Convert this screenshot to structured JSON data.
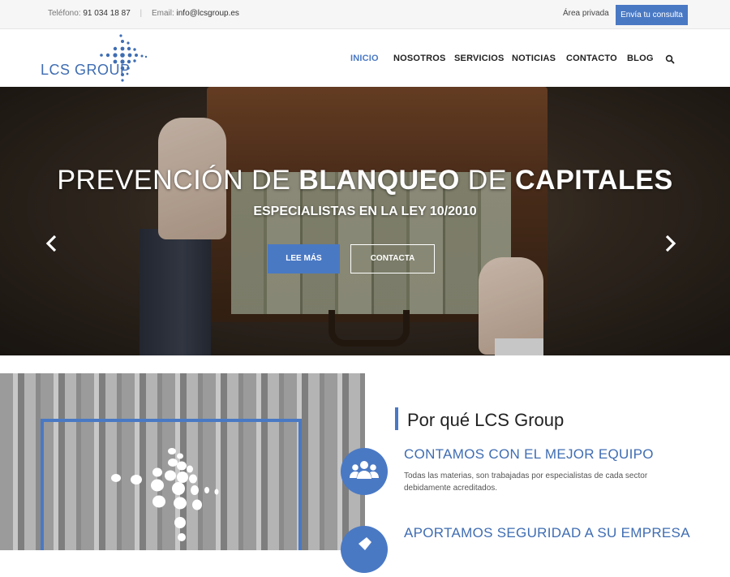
{
  "topbar": {
    "phone_label": "Teléfono:",
    "phone": "91 034 18 87",
    "separator": "|",
    "email_label": "Email:",
    "email": "info@lcsgroup.es",
    "private_area": "Área privada",
    "cta": "Envía tu consulta"
  },
  "header": {
    "logo_text": "LCS GROUP",
    "nav": [
      "INICIO",
      "NOSOTROS",
      "SERVICIOS",
      "NOTICIAS",
      "CONTACTO",
      "BLOG"
    ],
    "active_index": 0
  },
  "hero": {
    "title_part1": "PREVENCIÓN DE ",
    "title_part2": "BLANQUEO",
    "title_part3": " DE ",
    "title_part4": "CAPITALES",
    "subtitle": "ESPECIALISTAS EN LA LEY 10/2010",
    "button_primary": "LEE MÁS",
    "button_secondary": "CONTACTA"
  },
  "why": {
    "title": "Por qué LCS Group",
    "features": [
      {
        "title": "CONTAMOS CON EL MEJOR EQUIPO",
        "text": "Todas las materias, son trabajadas por especialistas de cada sector debidamente acreditados.",
        "icon": "team-icon"
      },
      {
        "title": "APORTAMOS SEGURIDAD A SU EMPRESA",
        "text": "",
        "icon": "security-icon"
      }
    ]
  },
  "colors": {
    "accent": "#4a79c4",
    "title_blue": "#3f6db3"
  }
}
